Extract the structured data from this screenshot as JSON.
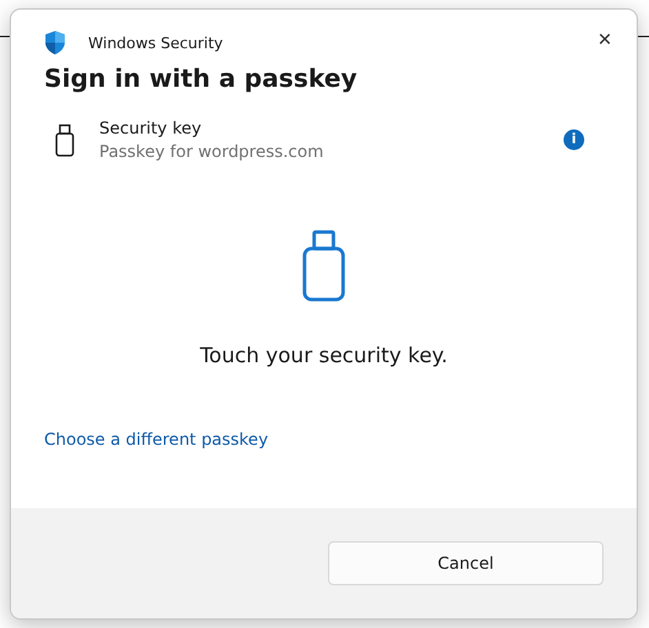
{
  "window": {
    "title": "Windows Security",
    "close": "✕"
  },
  "heading": "Sign in with a passkey",
  "credential": {
    "name": "Security key",
    "detail": "Passkey for wordpress.com",
    "info": "i"
  },
  "prompt": "Touch your security key.",
  "link": "Choose a different passkey",
  "buttons": [
    "Cancel"
  ]
}
